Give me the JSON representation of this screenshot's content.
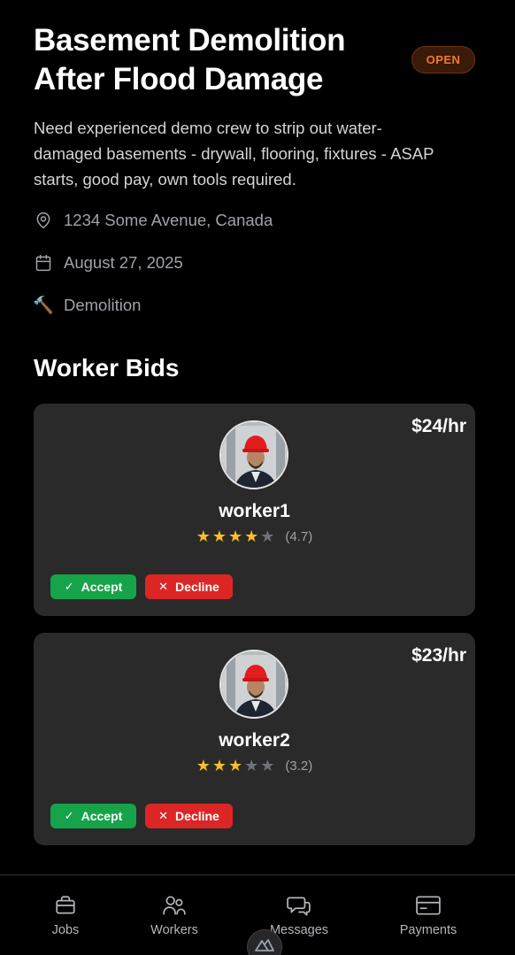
{
  "job": {
    "title": "Basement Demolition After Flood Damage",
    "status": "OPEN",
    "description": "Need experienced demo crew to strip out water-damaged basements - drywall, flooring, fixtures - ASAP starts, good pay, own tools required.",
    "location": "1234 Some Avenue, Canada",
    "date": "August 27, 2025",
    "category": "Demolition",
    "category_icon": "🔨"
  },
  "bids_section": {
    "title": "Worker Bids"
  },
  "bids": [
    {
      "rate": "$24/hr",
      "name": "worker1",
      "stars_filled": 4,
      "rating": "(4.7)",
      "accept_label": "Accept",
      "decline_label": "Decline"
    },
    {
      "rate": "$23/hr",
      "name": "worker2",
      "stars_filled": 3,
      "rating": "(3.2)",
      "accept_label": "Accept",
      "decline_label": "Decline"
    }
  ],
  "nav": {
    "items": [
      {
        "label": "Jobs",
        "icon": "briefcase-icon"
      },
      {
        "label": "Workers",
        "icon": "users-icon"
      },
      {
        "label": "Messages",
        "icon": "messages-icon"
      },
      {
        "label": "Payments",
        "icon": "credit-card-icon"
      }
    ]
  },
  "colors": {
    "background": "#000000",
    "card": "#2a2a2a",
    "accept": "#16a34a",
    "decline": "#dc2626",
    "status": "#f07a2a",
    "star": "#fbbf24"
  }
}
